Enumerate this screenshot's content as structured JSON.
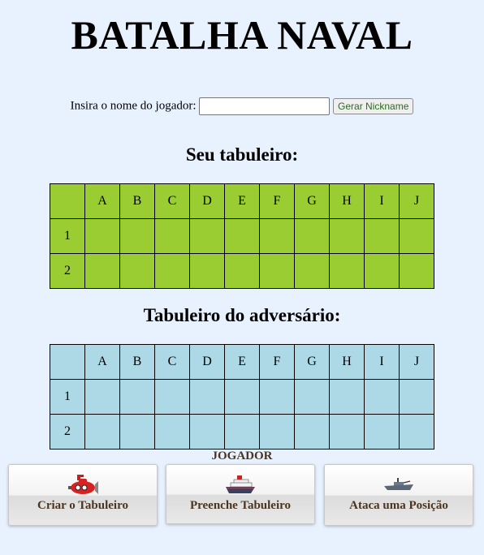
{
  "title": "BATALHA NAVAL",
  "nickname": {
    "label": "Insira o nome do jogador:",
    "value": "",
    "button": "Gerar Nickname"
  },
  "my_board": {
    "heading": "Seu tabuleiro:",
    "columns": [
      "A",
      "B",
      "C",
      "D",
      "E",
      "F",
      "G",
      "H",
      "I",
      "J"
    ],
    "rows": [
      "1",
      "2"
    ],
    "color": "#9acd32"
  },
  "enemy_board": {
    "heading": "Tabuleiro do adversário:",
    "columns": [
      "A",
      "B",
      "C",
      "D",
      "E",
      "F",
      "G",
      "H",
      "I",
      "J"
    ],
    "rows": [
      "1",
      "2"
    ],
    "color": "#add8e6"
  },
  "player_label": "JOGADOR",
  "actions": [
    {
      "label": "Criar o Tabuleiro",
      "icon": "submarine-icon"
    },
    {
      "label": "Preenche Tabuleiro",
      "icon": "cruise-ship-icon"
    },
    {
      "label": "Ataca uma Posição",
      "icon": "warship-icon"
    }
  ]
}
